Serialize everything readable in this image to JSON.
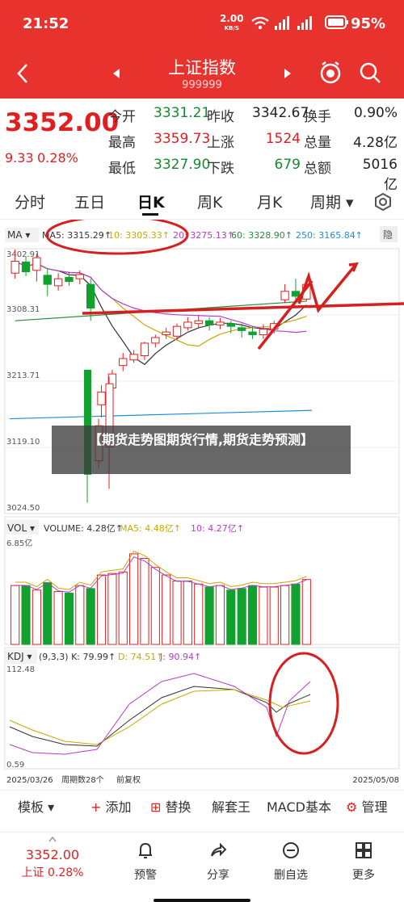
{
  "status": {
    "time": "21:52",
    "speed": "2.00",
    "speed_unit": "KB/S",
    "battery": "95%"
  },
  "nav": {
    "title": "上证指数",
    "code": "999999"
  },
  "quote": {
    "price": "3352.00",
    "change": "9.33",
    "pct": "0.28%",
    "rows": [
      [
        {
          "k": "今开",
          "v": "3331.21",
          "c": "green"
        },
        {
          "k": "昨收",
          "v": "3342.67",
          "c": "black"
        },
        {
          "k": "换手",
          "v": "0.90%",
          "c": "black"
        }
      ],
      [
        {
          "k": "最高",
          "v": "3359.73",
          "c": "red"
        },
        {
          "k": "上涨",
          "v": "1524",
          "c": "red"
        },
        {
          "k": "总量",
          "v": "4.28亿",
          "c": "black"
        }
      ],
      [
        {
          "k": "最低",
          "v": "3327.90",
          "c": "green"
        },
        {
          "k": "下跌",
          "v": "679",
          "c": "green"
        },
        {
          "k": "总额",
          "v": "5016亿",
          "c": "black"
        }
      ]
    ]
  },
  "tabs": {
    "items": [
      "分时",
      "五日",
      "日K",
      "周K",
      "月K",
      "周期"
    ],
    "active": 2
  },
  "ma": {
    "label": "MA",
    "items": [
      {
        "t": "MA5: 3315.29",
        "c": "#333333"
      },
      {
        "t": "10: 3305.33",
        "c": "#c9a800"
      },
      {
        "t": "20: 3275.13",
        "c": "#b43cc8"
      },
      {
        "t": "60: 3328.90",
        "c": "#2b8a3e"
      },
      {
        "t": "250: 3165.84",
        "c": "#1a8fd6"
      }
    ],
    "collapse": "隐"
  },
  "price_axis": [
    "3402.91",
    "3308.31",
    "3213.71",
    "3119.10",
    "3024.50"
  ],
  "overlay_caption": "【期货走势图期货行情,期货走势预测】",
  "vol": {
    "label": "VOL",
    "items": [
      {
        "t": "VOLUME: 4.28亿",
        "c": "#333333"
      },
      {
        "t": "MA5: 4.48亿",
        "c": "#c9a800"
      },
      {
        "t": "10: 4.27亿",
        "c": "#b43cc8"
      }
    ],
    "axis_top": "6.85亿"
  },
  "kdj": {
    "label": "KDJ",
    "items": [
      {
        "t": "(9,3,3) K: 79.99",
        "c": "#333333"
      },
      {
        "t": "D: 74.51",
        "c": "#c9a800"
      },
      {
        "t": "J: 90.94",
        "c": "#b43cc8"
      }
    ],
    "axis_top": "112.48",
    "axis_bottom": "0.59"
  },
  "dates": {
    "start": "2025/03/26",
    "period": "周期数28个",
    "adjust": "前复权",
    "end": "2025/05/08"
  },
  "toolbar": [
    "模板",
    "添加",
    "替换",
    "解套王",
    "MACD基本",
    "管理"
  ],
  "bottom": {
    "price": "3352.00",
    "sub": "上证 0.28%",
    "items": [
      "预警",
      "分享",
      "删自选",
      "更多"
    ]
  },
  "chart_data": {
    "type": "candlestick",
    "candles": [
      {
        "o": 3368,
        "c": 3385,
        "h": 3402,
        "l": 3360
      },
      {
        "o": 3384,
        "c": 3370,
        "h": 3392,
        "l": 3364
      },
      {
        "o": 3372,
        "c": 3390,
        "h": 3396,
        "l": 3356
      },
      {
        "o": 3365,
        "c": 3352,
        "h": 3375,
        "l": 3335
      },
      {
        "o": 3350,
        "c": 3360,
        "h": 3368,
        "l": 3343
      },
      {
        "o": 3362,
        "c": 3356,
        "h": 3370,
        "l": 3350
      },
      {
        "o": 3360,
        "c": 3366,
        "h": 3372,
        "l": 3352
      },
      {
        "o": 3352,
        "c": 3318,
        "h": 3360,
        "l": 3300
      },
      {
        "o": 3180,
        "c": 3198,
        "h": 3208,
        "l": 3162
      },
      {
        "o": 3204,
        "c": 3224,
        "h": 3230,
        "l": 3200
      },
      {
        "o": 3236,
        "c": 3246,
        "h": 3254,
        "l": 3228
      },
      {
        "o": 3244,
        "c": 3252,
        "h": 3258,
        "l": 3240
      },
      {
        "o": 3250,
        "c": 3268,
        "h": 3270,
        "l": 3244
      },
      {
        "o": 3268,
        "c": 3276,
        "h": 3280,
        "l": 3262
      },
      {
        "o": 3280,
        "c": 3284,
        "h": 3290,
        "l": 3274
      },
      {
        "o": 3278,
        "c": 3292,
        "h": 3296,
        "l": 3272
      },
      {
        "o": 3290,
        "c": 3298,
        "h": 3305,
        "l": 3286
      },
      {
        "o": 3296,
        "c": 3300,
        "h": 3308,
        "l": 3290
      },
      {
        "o": 3300,
        "c": 3294,
        "h": 3305,
        "l": 3286
      },
      {
        "o": 3294,
        "c": 3298,
        "h": 3304,
        "l": 3288
      },
      {
        "o": 3296,
        "c": 3292,
        "h": 3300,
        "l": 3282
      },
      {
        "o": 3290,
        "c": 3286,
        "h": 3296,
        "l": 3276
      },
      {
        "o": 3284,
        "c": 3280,
        "h": 3292,
        "l": 3274
      },
      {
        "o": 3280,
        "c": 3288,
        "h": 3295,
        "l": 3274
      },
      {
        "o": 3288,
        "c": 3296,
        "h": 3300,
        "l": 3282
      },
      {
        "o": 3330,
        "c": 3342,
        "h": 3352,
        "l": 3325
      },
      {
        "o": 3342,
        "c": 3335,
        "h": 3360,
        "l": 3328
      },
      {
        "o": 3331,
        "c": 3352,
        "h": 3360,
        "l": 3328
      }
    ],
    "volume": [
      3.9,
      3.9,
      3.6,
      4.1,
      3.5,
      3.4,
      3.9,
      3.7,
      4.6,
      4.7,
      4.8,
      6.0,
      5.7,
      5.1,
      4.6,
      4.2,
      4.2,
      4.0,
      3.8,
      3.9,
      3.6,
      3.7,
      3.9,
      3.8,
      3.8,
      3.9,
      4.0,
      4.3
    ],
    "ylim": [
      3024.5,
      3402.91
    ]
  }
}
